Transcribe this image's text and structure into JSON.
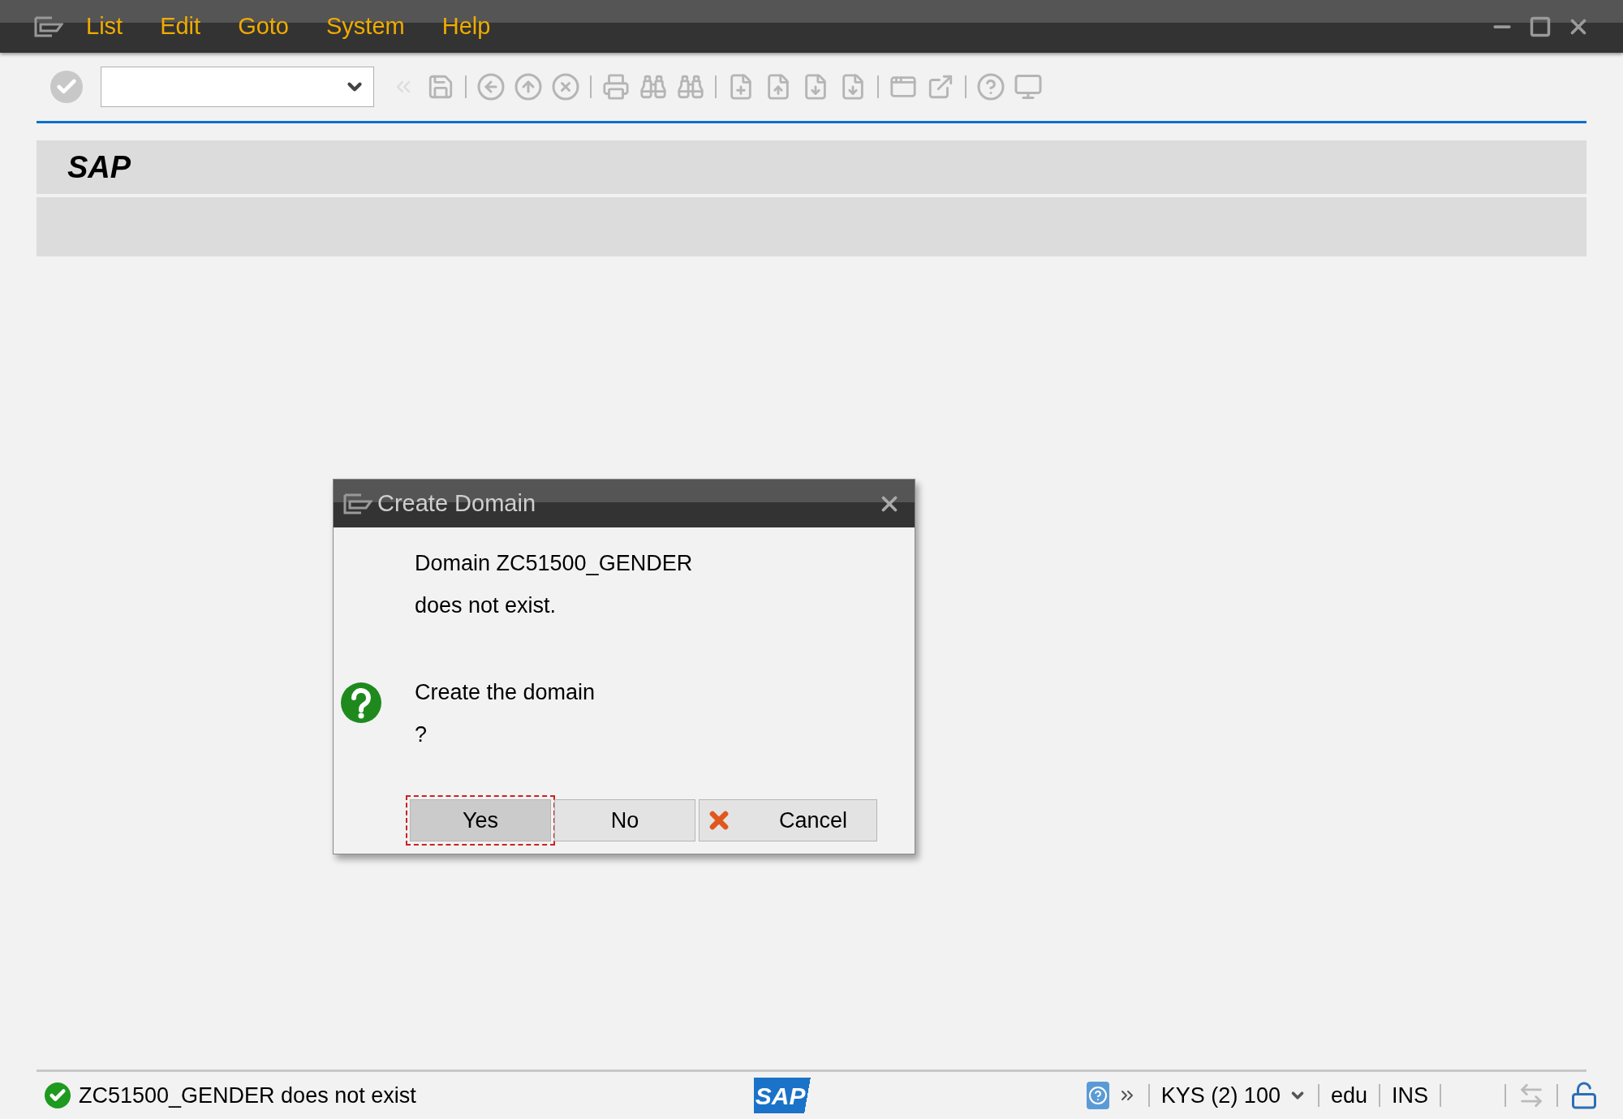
{
  "menu_bar": {
    "items": [
      {
        "label": "List"
      },
      {
        "label": "Edit"
      },
      {
        "label": "Goto"
      },
      {
        "label": "System"
      },
      {
        "label": "Help"
      }
    ]
  },
  "title": "SAP",
  "dialog": {
    "title": "Create Domain",
    "message_lines": [
      "Domain ZC51500_GENDER",
      "does not exist."
    ],
    "question_lines": [
      "Create the domain",
      "?"
    ],
    "buttons": [
      {
        "label": "Yes",
        "kind": "plain",
        "selected": true
      },
      {
        "label": "No",
        "kind": "plain",
        "selected": false
      },
      {
        "label": "Cancel",
        "kind": "cancel",
        "selected": false
      }
    ]
  },
  "status_bar": {
    "message": "ZC51500_GENDER does not exist",
    "logo": "SAP",
    "system": "KYS (2) 100",
    "user": "edu",
    "mode": "INS"
  }
}
